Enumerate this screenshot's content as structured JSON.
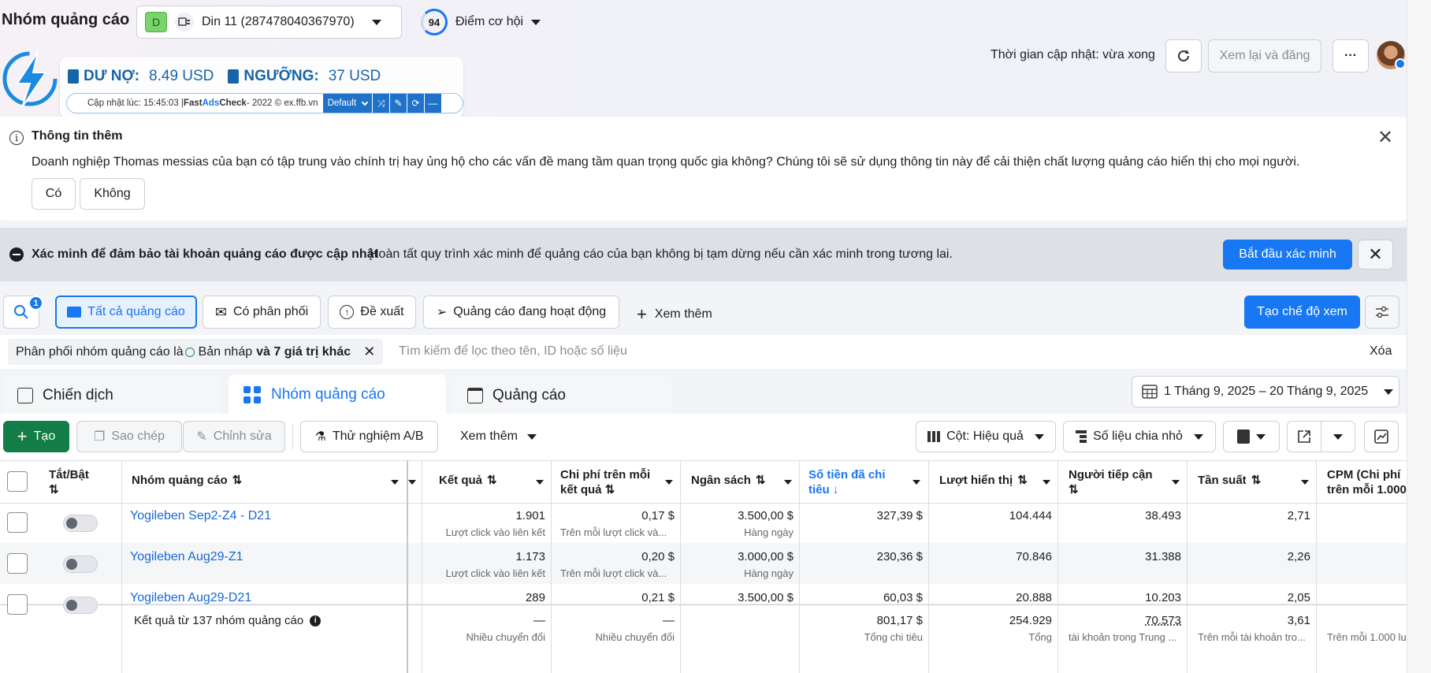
{
  "header": {
    "page_title": "Nhóm quảng cáo",
    "account_badge": "D",
    "account_name": "Din 11 (287478040367970)",
    "opportunity_score": "94",
    "opportunity_label": "Điểm cơ hội",
    "update_time": "Thời gian cập nhật: vừa xong",
    "review_publish": "Xem lại và đăng",
    "more": "···"
  },
  "fast_adscheck": {
    "debt_label": "DƯ NỢ:",
    "debt_value": "8.49 USD",
    "threshold_label": "NGƯỠNG:",
    "threshold_value": "37 USD",
    "updated_prefix": "Cập nhật lúc: 15:45:03 | ",
    "brand_fast": "Fast ",
    "brand_ads": "Ads",
    "brand_check": "Check",
    "copyright": " - 2022 © ex.ffb.vn",
    "preset": "Default"
  },
  "info_banner": {
    "title": "Thông tin thêm",
    "message": "Doanh nghiệp Thomas messias của bạn có tập trung vào chính trị hay ủng hộ cho các vấn đề mang tầm quan trọng quốc gia không? Chúng tôi sẽ sử dụng thông tin này để cải thiện chất lượng quảng cáo hiển thị cho mọi người.",
    "yes": "Có",
    "no": "Không"
  },
  "verify_banner": {
    "title": "Xác minh để đảm bảo tài khoản quảng cáo được cập nhật",
    "message": "Hoàn tất quy trình xác minh để quảng cáo của bạn không bị tạm dừng nếu cần xác minh trong tương lai.",
    "start": "Bắt đầu xác minh"
  },
  "filters": {
    "search_badge": "1",
    "all_ads": "Tất cả quảng cáo",
    "has_delivery": "Có phân phối",
    "suggested": "Đề xuất",
    "active_ads": "Quảng cáo đang hoạt động",
    "see_more": "Xem thêm",
    "create_view": "Tạo chế độ xem",
    "chip_prefix": "Phân phối nhóm quảng cáo là ",
    "chip_value": "Bản nháp",
    "chip_more": "và 7 giá trị khác",
    "search_placeholder": "Tìm kiếm để lọc theo tên, ID hoặc số liệu",
    "clear": "Xóa"
  },
  "tabs": {
    "campaigns": "Chiến dịch",
    "adsets": "Nhóm quảng cáo",
    "ads": "Quảng cáo",
    "date_range": "1 Tháng 9, 2025 – 20 Tháng 9, 2025"
  },
  "toolbar": {
    "create": "Tạo",
    "duplicate": "Sao chép",
    "edit": "Chỉnh sửa",
    "ab_test": "Thử nghiệm A/B",
    "more": "Xem thêm",
    "columns": "Cột: Hiệu quả",
    "breakdown": "Số liệu chia nhỏ"
  },
  "table": {
    "headers": {
      "toggle": "Tắt/Bật",
      "name": "Nhóm quảng cáo",
      "results": "Kết quả",
      "cost_per_result": "Chi phí trên mỗi kết quả",
      "budget": "Ngân sách",
      "amount_spent": "Số tiền đã chi tiêu",
      "impressions": "Lượt hiển thị",
      "reach": "Người tiếp cận",
      "frequency": "Tần suất",
      "cpm": "CPM (Chi phí trên mỗi 1.000"
    },
    "rows": [
      {
        "name": "Yogileben Sep2-Z4 - D21",
        "results": "1.901",
        "results_sub": "Lượt click vào liên kết",
        "cpr": "0,17 $",
        "cpr_sub": "Trên mỗi lượt click và...",
        "budget": "3.500,00 $",
        "budget_sub": "Hàng ngày",
        "spent": "327,39 $",
        "impressions": "104.444",
        "reach": "38.493",
        "frequency": "2,71"
      },
      {
        "name": "Yogileben Aug29-Z1",
        "results": "1.173",
        "results_sub": "Lượt click vào liên kết",
        "cpr": "0,20 $",
        "cpr_sub": "Trên mỗi lượt click và...",
        "budget": "3.000,00 $",
        "budget_sub": "Hàng ngày",
        "spent": "230,36 $",
        "impressions": "70.846",
        "reach": "31.388",
        "frequency": "2,26"
      },
      {
        "name": "Yogileben Aug29-D21",
        "results": "289",
        "results_sub": "",
        "cpr": "0,21 $",
        "cpr_sub": "",
        "budget": "3.500,00 $",
        "budget_sub": "",
        "spent": "60,03 $",
        "impressions": "20.888",
        "reach": "10.203",
        "frequency": "2,05"
      }
    ],
    "totals": {
      "label": "Kết quả từ 137 nhóm quảng cáo",
      "results": "—",
      "results_sub": "Nhiều chuyển đổi",
      "cpr": "—",
      "cpr_sub": "Nhiều chuyển đổi",
      "spent": "801,17 $",
      "spent_sub": "Tổng chi tiêu",
      "impressions": "254.929",
      "impressions_sub": "Tổng",
      "reach": "70.573",
      "reach_sub": "tài khoản trong Trung ...",
      "frequency": "3,61",
      "frequency_sub": "Trên mỗi tài khoản tro...",
      "cpm_sub": "Trên mỗi 1.000 lư"
    }
  },
  "colors": {
    "accent": "#1877f2",
    "green": "#127d47",
    "link": "#1768d6"
  }
}
